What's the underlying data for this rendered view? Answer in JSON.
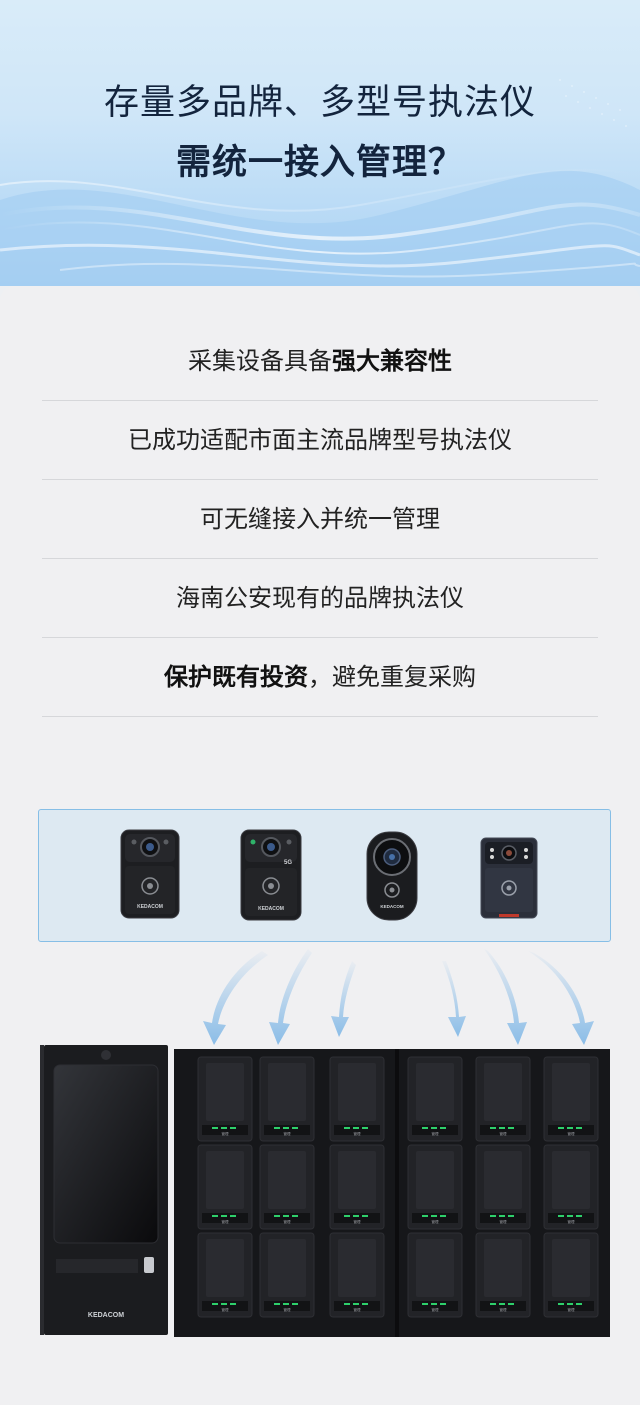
{
  "header": {
    "title_line1": "存量多品牌、多型号执法仪",
    "title_line2": "需统一接入管理？"
  },
  "features": {
    "row1_normal": "采集设备具备",
    "row1_bold": "强大兼容性",
    "row2": "已成功适配市面主流品牌型号执法仪",
    "row3": "可无缝接入并统一管理",
    "row4": "海南公安现有的品牌执法仪",
    "row5_bold": "保护既有投资",
    "row5_normal": "，避免重复采购"
  },
  "devices": {
    "brand_label": "KEDACOM",
    "badge_5g": "5G",
    "cameras": [
      "body-camera-1",
      "body-camera-2",
      "body-camera-3",
      "body-camera-4"
    ]
  },
  "cabinet": {
    "brand_label": "KEDACOM",
    "slot_label": "管理",
    "colors": {
      "body": "#1c1d20",
      "slot": "#222326",
      "led": "#2ed06b",
      "arrow": "#7fb7e6"
    }
  }
}
